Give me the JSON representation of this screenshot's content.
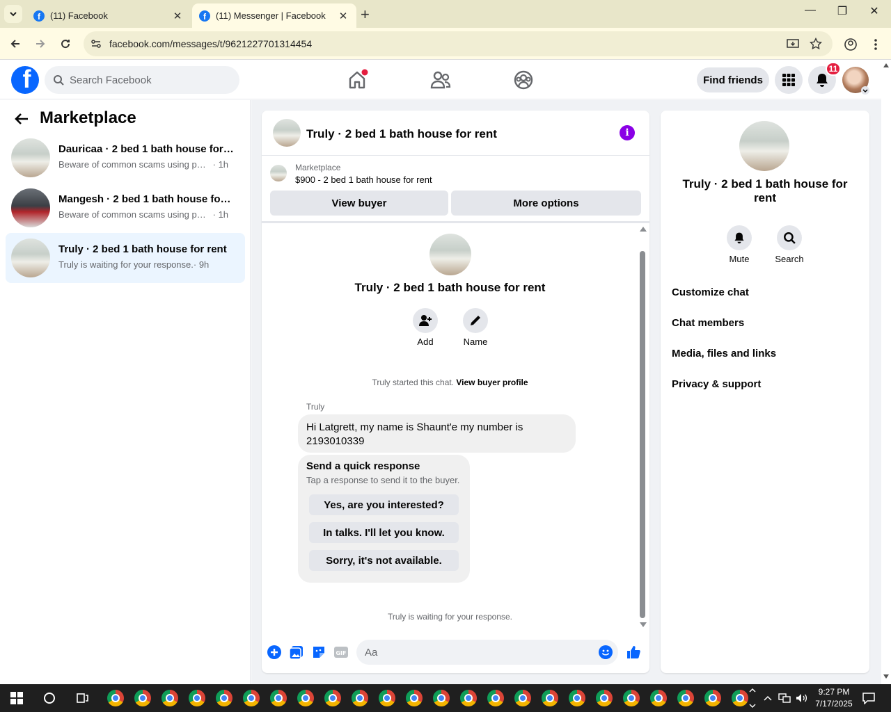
{
  "browser": {
    "tabs": [
      {
        "title": "(11) Facebook",
        "active": false
      },
      {
        "title": "(11) Messenger | Facebook",
        "active": true
      }
    ],
    "url": "facebook.com/messages/t/9621227701314454"
  },
  "fb": {
    "search_placeholder": "Search Facebook",
    "find_friends": "Find friends",
    "notification_count": "11",
    "colors": {
      "brand": "#0866ff",
      "badge": "#e41e3f",
      "accent": "#8a00e6"
    }
  },
  "sidebar": {
    "title": "Marketplace",
    "conversations": [
      {
        "name": "Dauricaa · 2 bed 1 bath house for rent",
        "snippet": "Beware of common scams using payment apps",
        "time": "· 1h"
      },
      {
        "name": "Mangesh · 2 bed 1 bath house for rent",
        "snippet": "Beware of common scams using payment apps",
        "time": "· 1h"
      },
      {
        "name": "Truly · 2 bed 1 bath house for rent",
        "snippet": "Truly is waiting for your response.",
        "time": "· 9h"
      }
    ]
  },
  "chat": {
    "title": "Truly · 2 bed 1 bath house for rent",
    "marketplace_label": "Marketplace",
    "listing": "$900 - 2 bed 1 bath house for rent",
    "view_buyer": "View buyer",
    "more_options": "More options",
    "intro_title": "Truly · 2 bed 1 bath house for rent",
    "add_label": "Add",
    "name_label": "Name",
    "started_text": "Truly started this chat.",
    "view_profile": "View buyer profile",
    "sender": "Truly",
    "message": "Hi Latgrett, my name is Shaunt'e my number is 2193010339",
    "quick_title": "Send a quick response",
    "quick_sub": "Tap a response to send it to the buyer.",
    "quick_replies": [
      "Yes, are you interested?",
      "In talks. I'll let you know.",
      "Sorry, it's not available."
    ],
    "waiting": "Truly is waiting for your response.",
    "input_placeholder": "Aa"
  },
  "details": {
    "title": "Truly · 2 bed 1 bath house for rent",
    "mute": "Mute",
    "search": "Search",
    "items": [
      "Customize chat",
      "Chat members",
      "Media, files and links",
      "Privacy & support"
    ]
  },
  "taskbar": {
    "time": "9:27 PM",
    "date": "7/17/2025"
  }
}
